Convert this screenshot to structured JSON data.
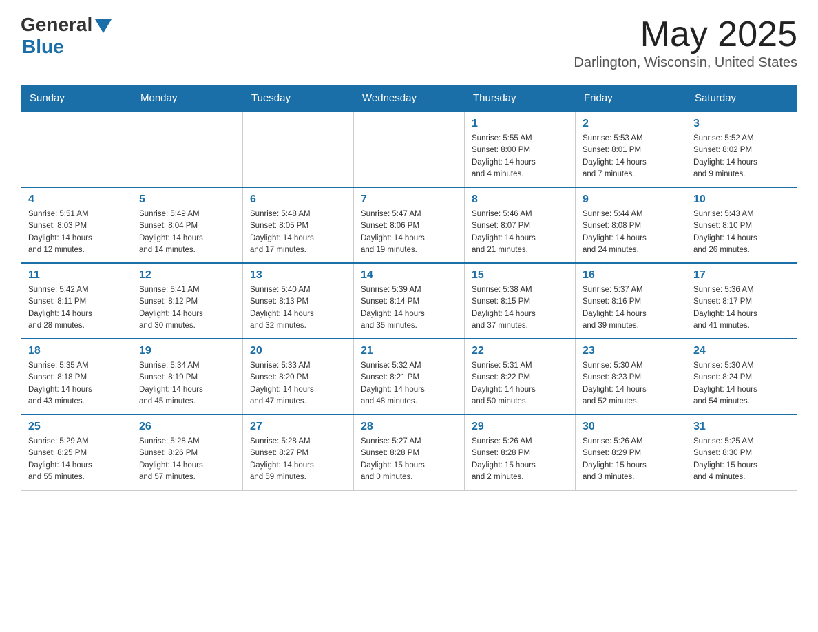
{
  "header": {
    "logo_general": "General",
    "logo_blue": "Blue",
    "month_title": "May 2025",
    "location": "Darlington, Wisconsin, United States"
  },
  "days_of_week": [
    "Sunday",
    "Monday",
    "Tuesday",
    "Wednesday",
    "Thursday",
    "Friday",
    "Saturday"
  ],
  "weeks": [
    [
      {
        "day": "",
        "info": ""
      },
      {
        "day": "",
        "info": ""
      },
      {
        "day": "",
        "info": ""
      },
      {
        "day": "",
        "info": ""
      },
      {
        "day": "1",
        "info": "Sunrise: 5:55 AM\nSunset: 8:00 PM\nDaylight: 14 hours\nand 4 minutes."
      },
      {
        "day": "2",
        "info": "Sunrise: 5:53 AM\nSunset: 8:01 PM\nDaylight: 14 hours\nand 7 minutes."
      },
      {
        "day": "3",
        "info": "Sunrise: 5:52 AM\nSunset: 8:02 PM\nDaylight: 14 hours\nand 9 minutes."
      }
    ],
    [
      {
        "day": "4",
        "info": "Sunrise: 5:51 AM\nSunset: 8:03 PM\nDaylight: 14 hours\nand 12 minutes."
      },
      {
        "day": "5",
        "info": "Sunrise: 5:49 AM\nSunset: 8:04 PM\nDaylight: 14 hours\nand 14 minutes."
      },
      {
        "day": "6",
        "info": "Sunrise: 5:48 AM\nSunset: 8:05 PM\nDaylight: 14 hours\nand 17 minutes."
      },
      {
        "day": "7",
        "info": "Sunrise: 5:47 AM\nSunset: 8:06 PM\nDaylight: 14 hours\nand 19 minutes."
      },
      {
        "day": "8",
        "info": "Sunrise: 5:46 AM\nSunset: 8:07 PM\nDaylight: 14 hours\nand 21 minutes."
      },
      {
        "day": "9",
        "info": "Sunrise: 5:44 AM\nSunset: 8:08 PM\nDaylight: 14 hours\nand 24 minutes."
      },
      {
        "day": "10",
        "info": "Sunrise: 5:43 AM\nSunset: 8:10 PM\nDaylight: 14 hours\nand 26 minutes."
      }
    ],
    [
      {
        "day": "11",
        "info": "Sunrise: 5:42 AM\nSunset: 8:11 PM\nDaylight: 14 hours\nand 28 minutes."
      },
      {
        "day": "12",
        "info": "Sunrise: 5:41 AM\nSunset: 8:12 PM\nDaylight: 14 hours\nand 30 minutes."
      },
      {
        "day": "13",
        "info": "Sunrise: 5:40 AM\nSunset: 8:13 PM\nDaylight: 14 hours\nand 32 minutes."
      },
      {
        "day": "14",
        "info": "Sunrise: 5:39 AM\nSunset: 8:14 PM\nDaylight: 14 hours\nand 35 minutes."
      },
      {
        "day": "15",
        "info": "Sunrise: 5:38 AM\nSunset: 8:15 PM\nDaylight: 14 hours\nand 37 minutes."
      },
      {
        "day": "16",
        "info": "Sunrise: 5:37 AM\nSunset: 8:16 PM\nDaylight: 14 hours\nand 39 minutes."
      },
      {
        "day": "17",
        "info": "Sunrise: 5:36 AM\nSunset: 8:17 PM\nDaylight: 14 hours\nand 41 minutes."
      }
    ],
    [
      {
        "day": "18",
        "info": "Sunrise: 5:35 AM\nSunset: 8:18 PM\nDaylight: 14 hours\nand 43 minutes."
      },
      {
        "day": "19",
        "info": "Sunrise: 5:34 AM\nSunset: 8:19 PM\nDaylight: 14 hours\nand 45 minutes."
      },
      {
        "day": "20",
        "info": "Sunrise: 5:33 AM\nSunset: 8:20 PM\nDaylight: 14 hours\nand 47 minutes."
      },
      {
        "day": "21",
        "info": "Sunrise: 5:32 AM\nSunset: 8:21 PM\nDaylight: 14 hours\nand 48 minutes."
      },
      {
        "day": "22",
        "info": "Sunrise: 5:31 AM\nSunset: 8:22 PM\nDaylight: 14 hours\nand 50 minutes."
      },
      {
        "day": "23",
        "info": "Sunrise: 5:30 AM\nSunset: 8:23 PM\nDaylight: 14 hours\nand 52 minutes."
      },
      {
        "day": "24",
        "info": "Sunrise: 5:30 AM\nSunset: 8:24 PM\nDaylight: 14 hours\nand 54 minutes."
      }
    ],
    [
      {
        "day": "25",
        "info": "Sunrise: 5:29 AM\nSunset: 8:25 PM\nDaylight: 14 hours\nand 55 minutes."
      },
      {
        "day": "26",
        "info": "Sunrise: 5:28 AM\nSunset: 8:26 PM\nDaylight: 14 hours\nand 57 minutes."
      },
      {
        "day": "27",
        "info": "Sunrise: 5:28 AM\nSunset: 8:27 PM\nDaylight: 14 hours\nand 59 minutes."
      },
      {
        "day": "28",
        "info": "Sunrise: 5:27 AM\nSunset: 8:28 PM\nDaylight: 15 hours\nand 0 minutes."
      },
      {
        "day": "29",
        "info": "Sunrise: 5:26 AM\nSunset: 8:28 PM\nDaylight: 15 hours\nand 2 minutes."
      },
      {
        "day": "30",
        "info": "Sunrise: 5:26 AM\nSunset: 8:29 PM\nDaylight: 15 hours\nand 3 minutes."
      },
      {
        "day": "31",
        "info": "Sunrise: 5:25 AM\nSunset: 8:30 PM\nDaylight: 15 hours\nand 4 minutes."
      }
    ]
  ]
}
